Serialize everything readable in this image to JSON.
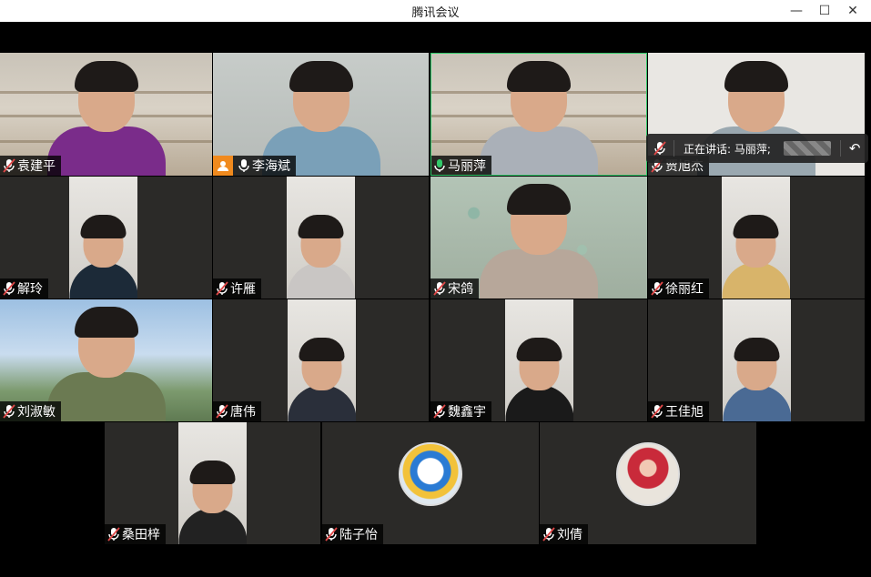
{
  "window": {
    "title": "腾讯会议",
    "controls": [
      "minimize",
      "maximize",
      "close"
    ],
    "control_glyphs": {
      "minimize": "—",
      "maximize": "☐",
      "close": "✕"
    }
  },
  "speaking": {
    "label": "正在讲话: 马丽萍;",
    "mic_state": "muted"
  },
  "participants": [
    {
      "name": "袁建平",
      "mic": "muted"
    },
    {
      "name": "李海斌",
      "mic": "active",
      "host_badge": true
    },
    {
      "name": "马丽萍",
      "mic": "speaking",
      "highlight": true
    },
    {
      "name": "贾旭杰",
      "mic": "muted"
    },
    {
      "name": "解玲",
      "mic": "muted"
    },
    {
      "name": "许雁",
      "mic": "muted"
    },
    {
      "name": "宋鸽",
      "mic": "muted"
    },
    {
      "name": "徐丽红",
      "mic": "muted"
    },
    {
      "name": "刘淑敏",
      "mic": "muted"
    },
    {
      "name": "唐伟",
      "mic": "muted"
    },
    {
      "name": "魏鑫宇",
      "mic": "muted"
    },
    {
      "name": "王佳旭",
      "mic": "muted"
    },
    {
      "name": "桑田梓",
      "mic": "muted"
    },
    {
      "name": "陆子怡",
      "mic": "muted",
      "avatar_only": true,
      "avatar": "duck-avatar-icon"
    },
    {
      "name": "刘倩",
      "mic": "muted",
      "avatar_only": true,
      "avatar": "child-photo-avatar"
    }
  ],
  "colors": {
    "accent_green": "#32c96a",
    "host_badge": "#f08a1e",
    "muted_red": "#e04848",
    "tile_bg": "#2b2a28"
  }
}
